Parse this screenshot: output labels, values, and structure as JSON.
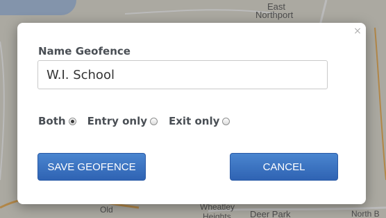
{
  "map": {
    "labels": [
      "East",
      "Northport",
      "Old",
      "Wheatley",
      "Heights",
      "Deer Park",
      "North B"
    ]
  },
  "dialog": {
    "close_symbol": "×",
    "field_label": "Name Geofence",
    "name_value": "W.I. School",
    "options": [
      {
        "label": "Both",
        "checked": true
      },
      {
        "label": "Entry only",
        "checked": false
      },
      {
        "label": "Exit only",
        "checked": false
      }
    ],
    "save_label": "SAVE GEOFENCE",
    "cancel_label": "CANCEL"
  },
  "colors": {
    "button_blue": "#3a70c0",
    "label_gray": "#4a4f55"
  }
}
